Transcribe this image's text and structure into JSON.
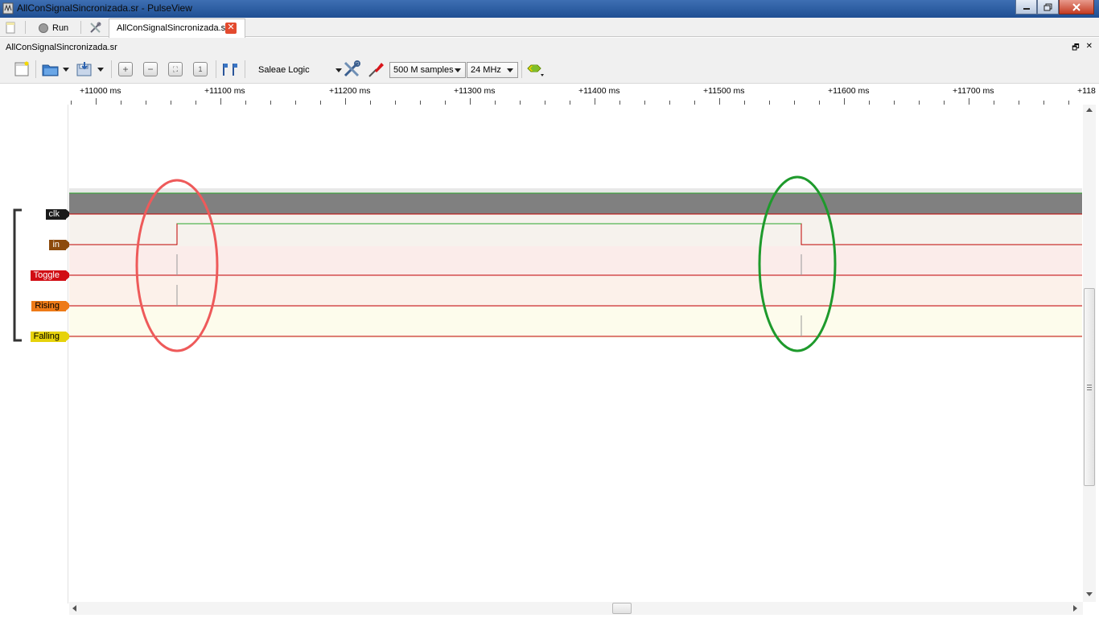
{
  "window": {
    "title": "AllConSignalSincronizada.sr - PulseView"
  },
  "tabbar": {
    "run_label": "Run",
    "document_tab": "AllConSignalSincronizada.sr",
    "close_glyph": "✕"
  },
  "document": {
    "name": "AllConSignalSincronizada.sr",
    "float_glyph": "🗗",
    "close_glyph": "✕"
  },
  "toolbar": {
    "device": "Saleae Logic",
    "sample_count": "500 M samples",
    "sample_rate": "24 MHz",
    "icons": [
      "new-session-icon",
      "open-icon",
      "save-icon",
      "zoom-in-icon",
      "zoom-out-icon",
      "zoom-fit-icon",
      "zoom-one-to-one-icon",
      "cursor-icon",
      "configure-device-icon",
      "probe-icon",
      "add-decoder-icon"
    ]
  },
  "ruler": {
    "ticks": [
      "+11000 ms",
      "+11100 ms",
      "+11200 ms",
      "+11300 ms",
      "+11400 ms",
      "+11500 ms",
      "+11600 ms",
      "+11700 ms",
      "+118"
    ]
  },
  "channels": [
    {
      "name": "clk",
      "color": "#1a1a1a",
      "text_color": "#ffffff"
    },
    {
      "name": "in",
      "color": "#8c4a0c",
      "text_color": "#ffffff"
    },
    {
      "name": "Toggle",
      "color": "#d10d14",
      "text_color": "#ffffff"
    },
    {
      "name": "Rising",
      "color": "#ee7a17",
      "text_color": "#000000"
    },
    {
      "name": "Falling",
      "color": "#e6d20b",
      "text_color": "#000000"
    }
  ],
  "annotations": {
    "rising_marker_color": "#ee5a5a",
    "falling_marker_color": "#1e9a2c"
  },
  "colors": {
    "trace_line": "#c00000",
    "high_level": "#00b000",
    "clk_fill": "#808080"
  }
}
